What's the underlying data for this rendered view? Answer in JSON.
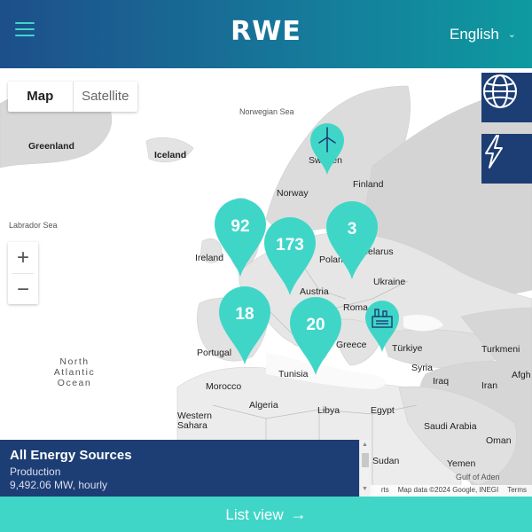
{
  "header": {
    "logo": "RWE",
    "language": "English"
  },
  "map": {
    "type_control": {
      "map_label": "Map",
      "satellite_label": "Satellite",
      "selected": "Map"
    },
    "zoom_in": "+",
    "zoom_out": "−",
    "places": {
      "norwegian_sea": "Norwegian Sea",
      "greenland": "Greenland",
      "iceland": "Iceland",
      "sweden": "Sweden",
      "finland": "Finland",
      "norway": "Norway",
      "labrador_sea": "Labrador Sea",
      "belarus": "Belarus",
      "ireland": "Ireland",
      "poland": "Poland",
      "ukraine": "Ukraine",
      "austria": "Austria",
      "romania": "Roma",
      "portugal": "Portugal",
      "greece": "Greece",
      "turkiye": "Türkiye",
      "turkmenistan": "Turkmeni",
      "north_atlantic_ocean": "North Atlantic Ocean",
      "syria": "Syria",
      "afghanistan": "Afgh",
      "morocco": "Morocco",
      "tunisia": "Tunisia",
      "iraq": "Iraq",
      "iran": "Iran",
      "algeria": "Algeria",
      "libya": "Libya",
      "egypt": "Egypt",
      "western_sahara": "Western Sahara",
      "saudi_arabia": "Saudi Arabia",
      "oman": "Oman",
      "sudan": "Sudan",
      "yemen": "Yemen",
      "gulf_of_aden": "Gulf of Aden"
    },
    "clusters": [
      {
        "id": "uk",
        "count": "92"
      },
      {
        "id": "central",
        "count": "173"
      },
      {
        "id": "poland",
        "count": "3"
      },
      {
        "id": "iberia",
        "count": "18"
      },
      {
        "id": "italy",
        "count": "20"
      }
    ],
    "icon_markers": [
      {
        "id": "sweden-wind",
        "icon": "wind-turbine-icon"
      },
      {
        "id": "turkiye-plant",
        "icon": "power-plant-icon"
      }
    ],
    "attribution": {
      "keyboard": "rts",
      "data": "Map data ©2024 Google, INEGI",
      "terms": "Terms"
    }
  },
  "side_buttons": [
    {
      "icon": "globe-icon"
    },
    {
      "icon": "lightning-icon"
    }
  ],
  "info_panel": {
    "title": "All Energy Sources",
    "subtitle": "Production",
    "value": "9,492.06 MW, hourly"
  },
  "list_view": {
    "label": "List view"
  },
  "colors": {
    "navy": "#1d3e74",
    "teal": "#3fd6c8",
    "header_gradient_start": "#1d4f8a",
    "header_gradient_end": "#0e9aa0"
  }
}
